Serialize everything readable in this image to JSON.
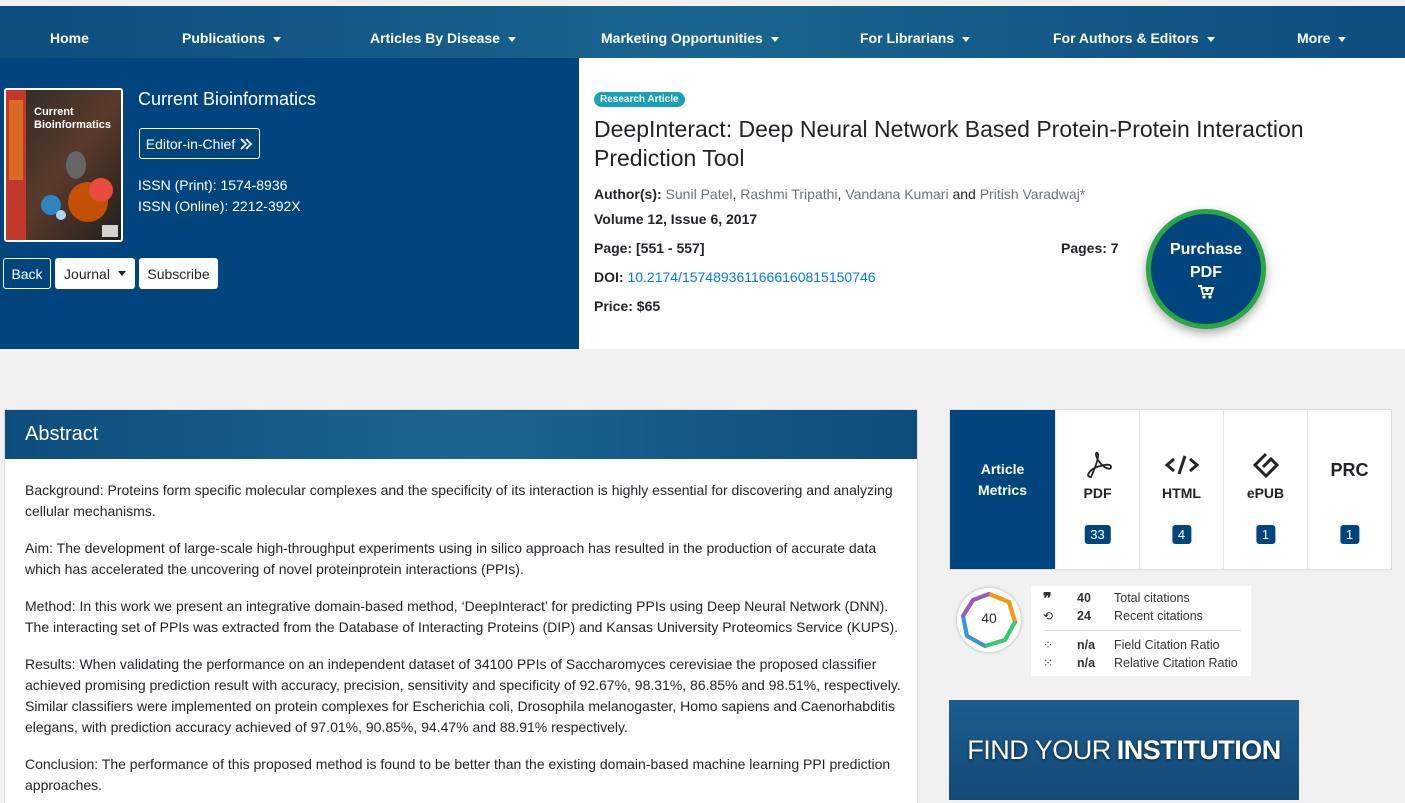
{
  "nav": {
    "items": [
      {
        "label": "Home",
        "dropdown": false
      },
      {
        "label": "Publications",
        "dropdown": true
      },
      {
        "label": "Articles By Disease",
        "dropdown": true
      },
      {
        "label": "Marketing Opportunities",
        "dropdown": true
      },
      {
        "label": "For Librarians",
        "dropdown": true
      },
      {
        "label": "For Authors & Editors",
        "dropdown": true
      },
      {
        "label": "More",
        "dropdown": true
      }
    ]
  },
  "journal": {
    "name": "Current Bioinformatics",
    "cover_title_line1": "Current",
    "cover_title_line2": "Bioinformatics",
    "editor_button": "Editor-in-Chief",
    "issn_print": "ISSN (Print): 1574-8936",
    "issn_online": "ISSN (Online): 2212-392X",
    "buttons": {
      "back": "Back",
      "journal": "Journal",
      "subscribe": "Subscribe"
    }
  },
  "article": {
    "badge": "Research Article",
    "title": "DeepInteract: Deep Neural Network Based Protein-Protein Interaction Prediction Tool",
    "authors_label": "Author(s):",
    "authors": [
      {
        "name": "Sunil Patel",
        "sep": ", "
      },
      {
        "name": "Rashmi Tripathi",
        "sep": ", "
      },
      {
        "name": "Vandana Kumari",
        "sep": " and "
      },
      {
        "name": "Pritish Varadwaj*",
        "sep": ""
      }
    ],
    "volume": "Volume 12, Issue 6, 2017",
    "page_label": "Page: [551 - 557]",
    "pages_label": "Pages: 7",
    "doi_label": "DOI:",
    "doi": "10.2174/1574893611666160815150746",
    "price": "Price: $65",
    "purchase_line1": "Purchase",
    "purchase_line2": "PDF",
    "purchase_icon": "cart-icon"
  },
  "abstract": {
    "heading": "Abstract",
    "paragraphs": [
      "Background: Proteins form specific molecular complexes and the specificity of its interaction is highly essential for discovering and analyzing cellular mechanisms.",
      "Aim: The development of large-scale high-throughput experiments using in silico approach has resulted in the production of accurate data which has accelerated the uncovering of novel proteinprotein interactions (PPIs).",
      "Method: In this work we present an integrative domain-based method, ‘DeepInteract’ for predicting PPIs using Deep Neural Network (DNN). The interacting set of PPIs was extracted from the Database of Interacting Proteins (DIP) and Kansas University Proteomics Service (KUPS).",
      "Results: When validating the performance on an independent dataset of 34100 PPIs of Saccharomyces cerevisiae the proposed classifier achieved promising prediction result with accuracy, precision, sensitivity and specificity of 92.67%, 98.31%, 86.85% and 98.51%, respectively. Similar classifiers were implemented on protein complexes for Escherichia coli, Drosophila melanogaster, Homo sapiens and Caenorhabditis elegans, with prediction accuracy achieved of 97.01%, 90.85%, 94.47% and 88.91% respectively.",
      "Conclusion: The performance of this proposed method is found to be better than the existing domain-based machine learning PPI prediction approaches."
    ]
  },
  "metrics": {
    "label_line1": "Article",
    "label_line2": "Metrics",
    "items": [
      {
        "icon": "pdf-icon",
        "name": "PDF",
        "count": "33"
      },
      {
        "icon": "html-code-icon",
        "name": "HTML",
        "count": "4"
      },
      {
        "icon": "epub-icon",
        "name": "ePUB",
        "count": "1"
      },
      {
        "icon": "prc-icon",
        "name": "PRC",
        "count": "1"
      }
    ]
  },
  "citations": {
    "badge_value": "40",
    "total_value": "40",
    "total_label": "Total citations",
    "recent_value": "24",
    "recent_label": "Recent citations",
    "fcr_value": "n/a",
    "fcr_label": "Field Citation Ratio",
    "rcr_value": "n/a",
    "rcr_label": "Relative Citation Ratio"
  },
  "banner": {
    "text_light": "FIND YOUR",
    "text_bold": "INSTITUTION"
  },
  "colors": {
    "brand_blue": "#00457e",
    "accent_green": "#28a745",
    "badge_teal": "#17a2b8",
    "link_blue": "#007bff"
  }
}
